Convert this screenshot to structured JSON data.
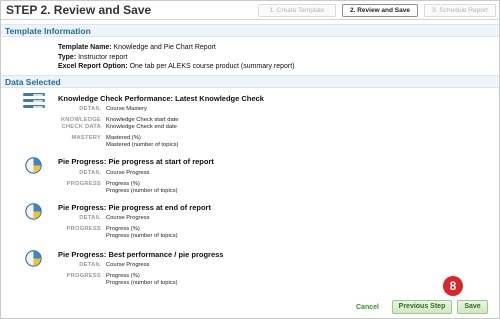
{
  "header": {
    "title": "STEP 2. Review and Save",
    "steps": [
      {
        "label": "1. Create Template"
      },
      {
        "label": "2. Review and Save"
      },
      {
        "label": "3. Schedule Report"
      }
    ]
  },
  "template_info": {
    "heading": "Template Information",
    "name_label": "Template Name:",
    "name_value": "Knowledge and Pie Chart Report",
    "type_label": "Type:",
    "type_value": "Instructor report",
    "option_label": "Excel Report Option:",
    "option_value": "One tab per ALEKS course product (summary report)"
  },
  "data_selected": {
    "heading": "Data Selected",
    "items": [
      {
        "title": "Knowledge Check Performance: Latest Knowledge Check",
        "icon": "bar-list-icon",
        "detail_key": "DETAIL",
        "detail_value": "Course Mastery",
        "date_key1": "KNOWLEDGE",
        "date_key2": "CHECK DATA",
        "date_value1": "Knowledge Check start date",
        "date_value2": "Knowledge Check end date",
        "metric_key": "MASTERY",
        "metric_value1": "Mastered (%)",
        "metric_value2": "Mastered (number of topics)"
      },
      {
        "title": "Pie Progress: Pie progress at start of report",
        "icon": "pie-chart-icon",
        "detail_key": "DETAIL",
        "detail_value": "Course Progress",
        "metric_key": "PROGRESS",
        "metric_value1": "Progress (%)",
        "metric_value2": "Progress (number of topics)"
      },
      {
        "title": "Pie Progress: Pie progress at end of report",
        "icon": "pie-chart-icon",
        "detail_key": "DETAIL",
        "detail_value": "Course Progress",
        "metric_key": "PROGRESS",
        "metric_value1": "Progress (%)",
        "metric_value2": "Progress (number of topics)"
      },
      {
        "title": "Pie Progress: Best performance / pie progress",
        "icon": "pie-chart-icon",
        "detail_key": "DETAIL",
        "detail_value": "Course Progress",
        "metric_key": "PROGRESS",
        "metric_value1": "Progress (%)",
        "metric_value2": "Progress (number of topics)"
      }
    ]
  },
  "footer": {
    "cancel_label": "Cancel",
    "previous_label": "Previous Step",
    "save_label": "Save",
    "callout_number": "8"
  },
  "colors": {
    "section_heading": "#1e6d9c",
    "button_text": "#2f6b1f",
    "callout": "#d9262c"
  }
}
